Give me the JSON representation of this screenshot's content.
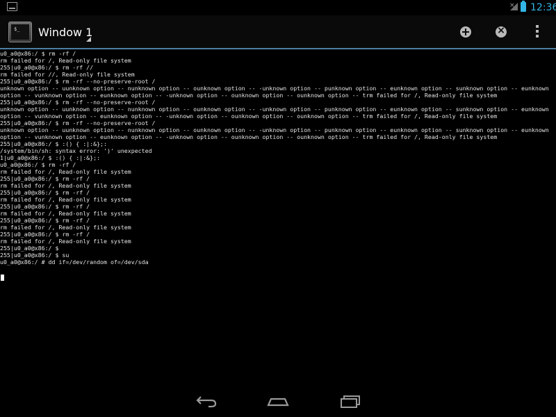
{
  "status_bar": {
    "time": "12:36",
    "icons": [
      "notification-icon",
      "signal-icon",
      "battery-icon"
    ],
    "accent": "#33b5e5"
  },
  "action_bar": {
    "window_title": "Window 1",
    "app_icon_prompt": "$_",
    "buttons": [
      "new-window",
      "close-window",
      "overflow-menu"
    ],
    "divider_color": "#4d7fa3"
  },
  "terminal": {
    "lines": [
      "u0_a0@x86:/ $ rm -rf /",
      "rm failed for /, Read-only file system",
      "255|u0_a0@x86:/ $ rm -rf //",
      "rm failed for //, Read-only file system",
      "255|u0_a0@x86:/ $ rm -rf --no-preserve-root /",
      "unknown option -- uunknown option -- nunknown option -- ounknown option -- -unknown option -- punknown option -- eunknown option -- sunknown option -- eunknown",
      "option -- vunknown option -- eunknown option -- -unknown option -- ounknown option -- ounknown option -- trm failed for /, Read-only file system",
      "255|u0_a0@x86:/ $ rm -rf --no-preserve-root /",
      "unknown option -- uunknown option -- nunknown option -- ounknown option -- -unknown option -- punknown option -- eunknown option -- sunknown option -- eunknown",
      "option -- vunknown option -- eunknown option -- -unknown option -- ounknown option -- ounknown option -- trm failed for /, Read-only file system",
      "255|u0_a0@x86:/ $ rm -rf --no-preserve-root /",
      "unknown option -- uunknown option -- nunknown option -- ounknown option -- -unknown option -- punknown option -- eunknown option -- sunknown option -- eunknown",
      "option -- vunknown option -- eunknown option -- -unknown option -- ounknown option -- ounknown option -- trm failed for /, Read-only file system",
      "255|u0_a0@x86:/ $ :() { :|:&};:",
      "/system/bin/sh: syntax error: ')' unexpected",
      "1|u0_a0@x86:/ $ :() { :|:&};:",
      "u0_a0@x86:/ $ rm -rf /",
      "rm failed for /, Read-only file system",
      "255|u0_a0@x86:/ $ rm -rf /",
      "rm failed for /, Read-only file system",
      "255|u0_a0@x86:/ $ rm -rf /",
      "rm failed for /, Read-only file system",
      "255|u0_a0@x86:/ $ rm -rf /",
      "rm failed for /, Read-only file system",
      "255|u0_a0@x86:/ $ rm -rf /",
      "rm failed for /, Read-only file system",
      "255|u0_a0@x86:/ $ rm -rf /",
      "rm failed for /, Read-only file system",
      "255|u0_a0@x86:/ $",
      "255|u0_a0@x86:/ $ su",
      "u0_a0@x86:/ # dd if=/dev/random of=/dev/sda"
    ],
    "text_color": "#e6e6e6",
    "background": "#000000"
  },
  "nav_bar": {
    "buttons": [
      "back-icon",
      "home-icon",
      "recents-icon"
    ]
  }
}
